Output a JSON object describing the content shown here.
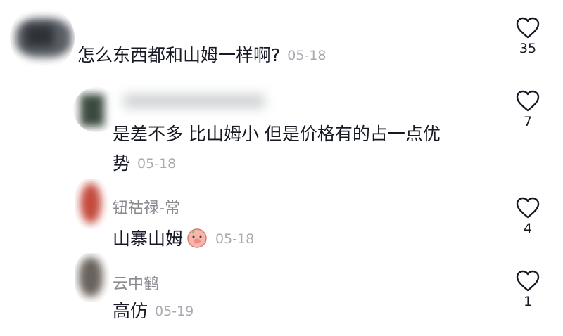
{
  "comments": [
    {
      "name": "",
      "text": "怎么东西都和山姆一样啊?",
      "time": "05-18",
      "likes": "35"
    },
    {
      "name": "",
      "text_line1": "是差不多 比山姆小 但是价格有的占一点优",
      "text_line2": "势",
      "time": "05-18",
      "likes": "7"
    },
    {
      "name": "钮祜禄-常",
      "text": "山寨山姆",
      "emoji": "pig-face-emoji",
      "time": "05-18",
      "likes": "4"
    },
    {
      "name": "云中鹤",
      "text": "高仿",
      "time": "05-19",
      "likes": "1"
    }
  ],
  "icons": {
    "like": "heart-outline-icon"
  }
}
